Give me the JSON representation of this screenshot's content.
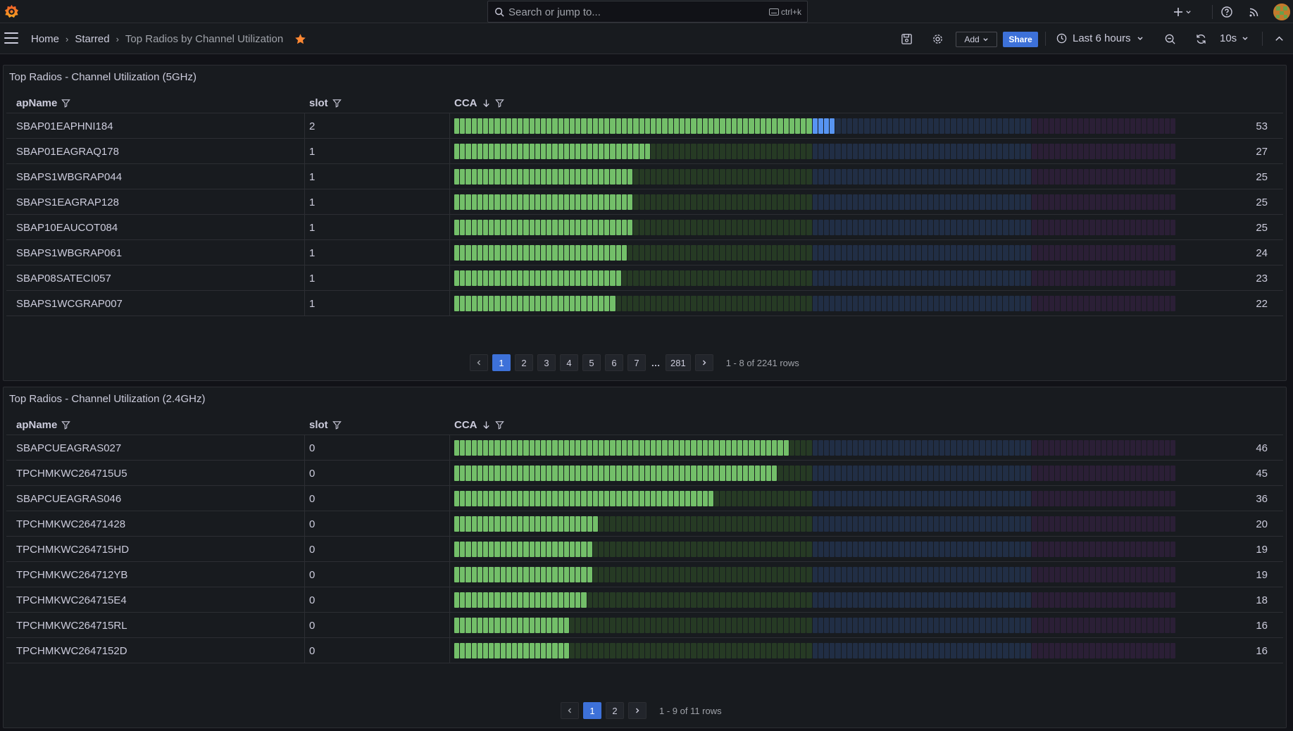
{
  "topbar": {
    "search_placeholder": "Search or jump to...",
    "search_shortcut": "ctrl+k"
  },
  "nav": {
    "breadcrumbs": [
      "Home",
      "Starred",
      "Top Radios by Channel Utilization"
    ],
    "add_label": "Add",
    "share_label": "Share",
    "time_range": "Last 6 hours",
    "refresh_interval": "10s"
  },
  "colors": {
    "green": "#73bf69",
    "green_dim": "#263a24",
    "blue": "#5794f2",
    "blue_dim": "#212e45",
    "purple_dim": "#2b1f36",
    "accent": "#3d71d9"
  },
  "gauge": {
    "segments": 125,
    "thresholds": [
      {
        "from": 0,
        "to": 50,
        "color_key": "green"
      },
      {
        "from": 50,
        "to": 80,
        "color_key": "blue"
      },
      {
        "from": 80,
        "to": 100,
        "color_key": "purple"
      }
    ],
    "max": 100
  },
  "panels": [
    {
      "title": "Top Radios - Channel Utilization (5GHz)",
      "columns": [
        "apName",
        "slot",
        "CCA"
      ],
      "rows": [
        {
          "apName": "SBAP01EAPHNI184",
          "slot": "2",
          "cca": 53
        },
        {
          "apName": "SBAP01EAGRAQ178",
          "slot": "1",
          "cca": 27
        },
        {
          "apName": "SBAPS1WBGRAP044",
          "slot": "1",
          "cca": 25
        },
        {
          "apName": "SBAPS1EAGRAP128",
          "slot": "1",
          "cca": 25
        },
        {
          "apName": "SBAP10EAUCOT084",
          "slot": "1",
          "cca": 25
        },
        {
          "apName": "SBAPS1WBGRAP061",
          "slot": "1",
          "cca": 24
        },
        {
          "apName": "SBAP08SATECI057",
          "slot": "1",
          "cca": 23
        },
        {
          "apName": "SBAPS1WCGRAP007",
          "slot": "1",
          "cca": 22
        }
      ],
      "pages": [
        "1",
        "2",
        "3",
        "4",
        "5",
        "6",
        "7",
        "…",
        "281"
      ],
      "active_page": "1",
      "row_info": "1 - 8 of 2241 rows"
    },
    {
      "title": "Top Radios - Channel Utilization (2.4GHz)",
      "columns": [
        "apName",
        "slot",
        "CCA"
      ],
      "rows": [
        {
          "apName": "SBAPCUEAGRAS027",
          "slot": "0",
          "cca": 46
        },
        {
          "apName": "TPCHMKWC264715U5",
          "slot": "0",
          "cca": 45
        },
        {
          "apName": "SBAPCUEAGRAS046",
          "slot": "0",
          "cca": 36
        },
        {
          "apName": "TPCHMKWC26471428",
          "slot": "0",
          "cca": 20
        },
        {
          "apName": "TPCHMKWC264715HD",
          "slot": "0",
          "cca": 19
        },
        {
          "apName": "TPCHMKWC264712YB",
          "slot": "0",
          "cca": 19
        },
        {
          "apName": "TPCHMKWC264715E4",
          "slot": "0",
          "cca": 18
        },
        {
          "apName": "TPCHMKWC264715RL",
          "slot": "0",
          "cca": 16
        },
        {
          "apName": "TPCHMKWC2647152D",
          "slot": "0",
          "cca": 16
        }
      ],
      "pages": [
        "1",
        "2"
      ],
      "active_page": "1",
      "row_info": "1 - 9 of 11 rows"
    }
  ]
}
